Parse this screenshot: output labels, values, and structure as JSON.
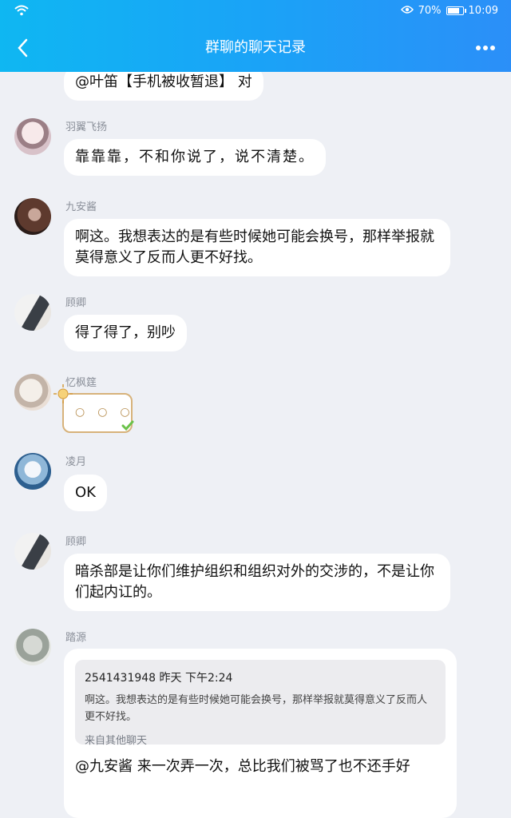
{
  "status": {
    "battery": "70%",
    "time": "10:09",
    "battery_level": 0.7
  },
  "header": {
    "title": "群聊的聊天记录"
  },
  "messages": [
    {
      "text": "@叶笛【手机被收暂退】 对"
    },
    {
      "name": "羽翼飞扬",
      "text": "靠靠靠，不和你说了，说不清楚。"
    },
    {
      "name": "九安酱",
      "text": "啊这。我想表达的是有些时候她可能会换号，那样举报就莫得意义了反而人更不好找。"
    },
    {
      "name": "顾卿",
      "text": "得了得了，别吵"
    },
    {
      "name": "忆枫筳"
    },
    {
      "name": "凌月",
      "text": "OK"
    },
    {
      "name": "顾卿",
      "text": "暗杀部是让你们维护组织和组织对外的交涉的，不是让你们起内讧的。"
    },
    {
      "name": "踏源",
      "quote": {
        "head": "2541431948 昨天 下午2:24",
        "text": "啊这。我想表达的是有些时候她可能会换号，那样举报就莫得意义了反而人更不好找。",
        "source": "来自其他聊天"
      },
      "text": "@九安酱 来一次弄一次，总比我们被骂了也不还手好"
    }
  ],
  "colors": {
    "header": "#1aa3f7",
    "background": "#eef0f5"
  }
}
